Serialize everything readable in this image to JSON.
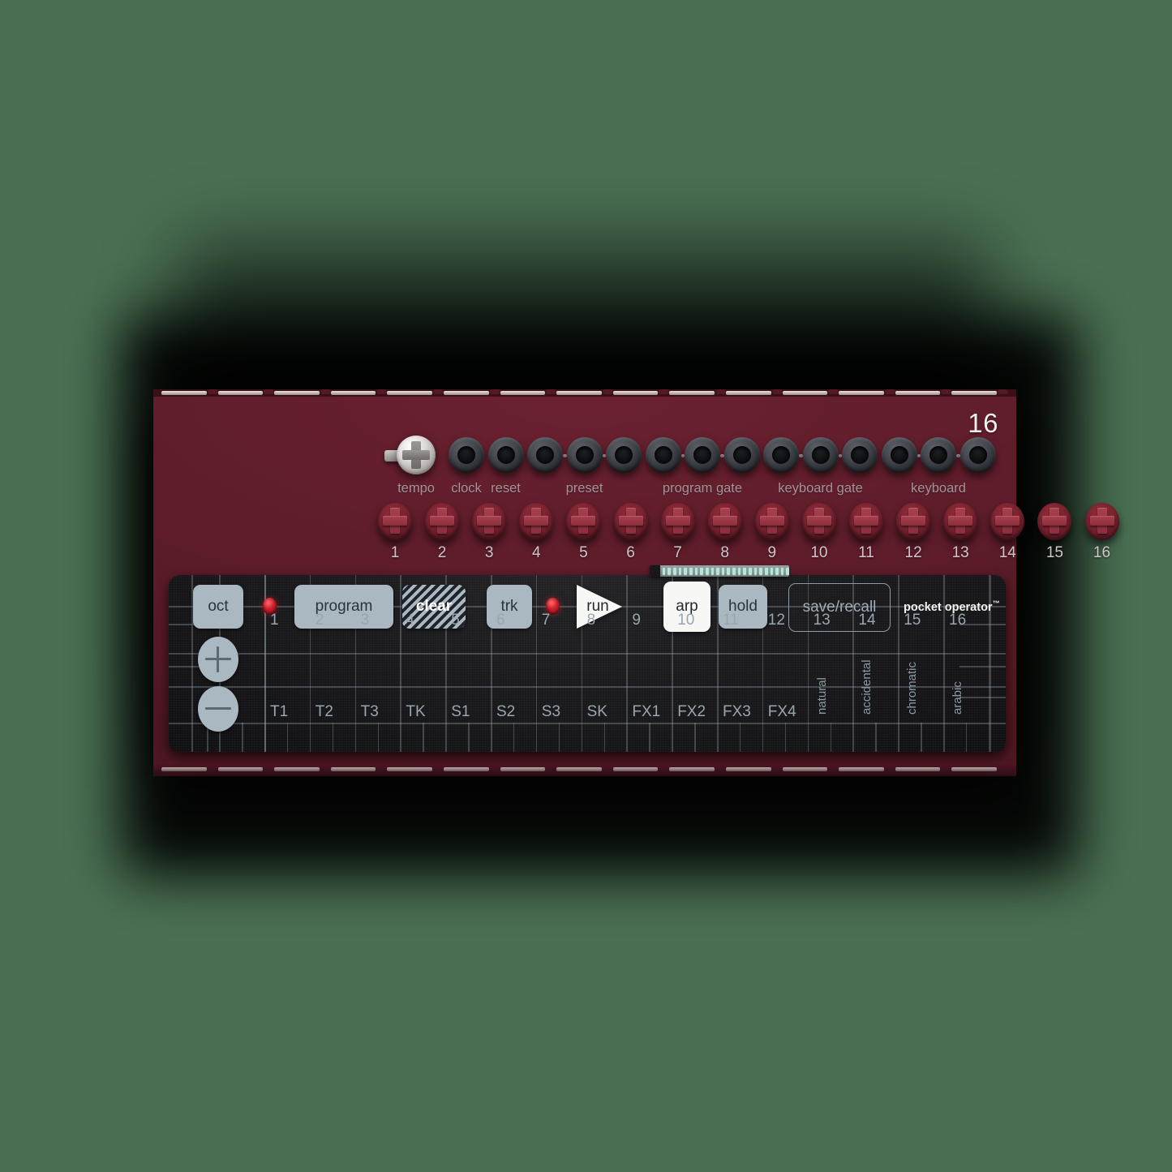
{
  "device": {
    "brand_mark": "pocket operator",
    "trademark": "™",
    "model_number": "16",
    "body_color": "#5c1c29",
    "panel_color": "#1a1a1c",
    "accent_button_color": "#aab8c2",
    "led_color": "#d0202c",
    "background_color": "#4a7053"
  },
  "io": {
    "knob": {
      "label": "tempo",
      "name": "tempo-knob"
    },
    "jack_groups": [
      {
        "label": "clock",
        "jacks": 1
      },
      {
        "label": "reset",
        "jacks": 1
      },
      {
        "label": "preset",
        "jacks": 3
      },
      {
        "label": "program gate",
        "jacks": 3
      },
      {
        "label": "keyboard gate",
        "jacks": 3
      },
      {
        "label": "keyboard",
        "jacks": 3
      }
    ]
  },
  "keys": {
    "count": 16,
    "numbers": [
      "1",
      "2",
      "3",
      "4",
      "5",
      "6",
      "7",
      "8",
      "9",
      "10",
      "11",
      "12",
      "13",
      "14",
      "15",
      "16"
    ]
  },
  "panel": {
    "controls": [
      {
        "id": "oct",
        "label": "oct",
        "style": "fill"
      },
      {
        "id": "led-1",
        "label": "",
        "style": "led"
      },
      {
        "id": "program",
        "label": "program",
        "style": "fill"
      },
      {
        "id": "clear",
        "label": "clear",
        "style": "hatch"
      },
      {
        "id": "trk",
        "label": "trk",
        "style": "fill"
      },
      {
        "id": "led-2",
        "label": "",
        "style": "led"
      },
      {
        "id": "run",
        "label": "run",
        "style": "triangle"
      },
      {
        "id": "arp",
        "label": "arp",
        "style": "white"
      },
      {
        "id": "hold",
        "label": "hold",
        "style": "fill"
      },
      {
        "id": "save-recall",
        "label": "save/recall",
        "style": "outline"
      }
    ],
    "octave_up": "+",
    "octave_down": "−",
    "step_numbers": [
      "1",
      "2",
      "3",
      "4",
      "5",
      "6",
      "7",
      "8",
      "9",
      "10",
      "11",
      "12",
      "13",
      "14",
      "15",
      "16"
    ],
    "step_labels": [
      "T1",
      "T2",
      "T3",
      "TK",
      "S1",
      "S2",
      "S3",
      "SK",
      "FX1",
      "FX2",
      "FX3",
      "FX4"
    ],
    "mode_labels": [
      "natural",
      "accidental",
      "chromatic",
      "arabic"
    ],
    "ribbon_segments": 24
  }
}
